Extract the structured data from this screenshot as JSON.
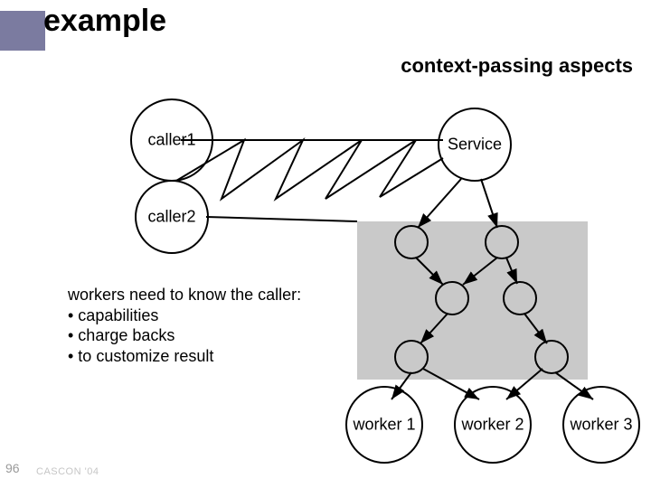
{
  "title": "example",
  "subtitle": "context-passing aspects",
  "nodes": {
    "caller1": "caller1",
    "caller2": "caller2",
    "service": "Service",
    "worker1": "worker 1",
    "worker2": "worker 2",
    "worker3": "worker 3"
  },
  "body": {
    "heading": "workers need to know the caller:",
    "bullet1": "• capabilities",
    "bullet2": "• charge backs",
    "bullet3": "• to customize result"
  },
  "page_number": "96",
  "footer": "CASCON '04"
}
